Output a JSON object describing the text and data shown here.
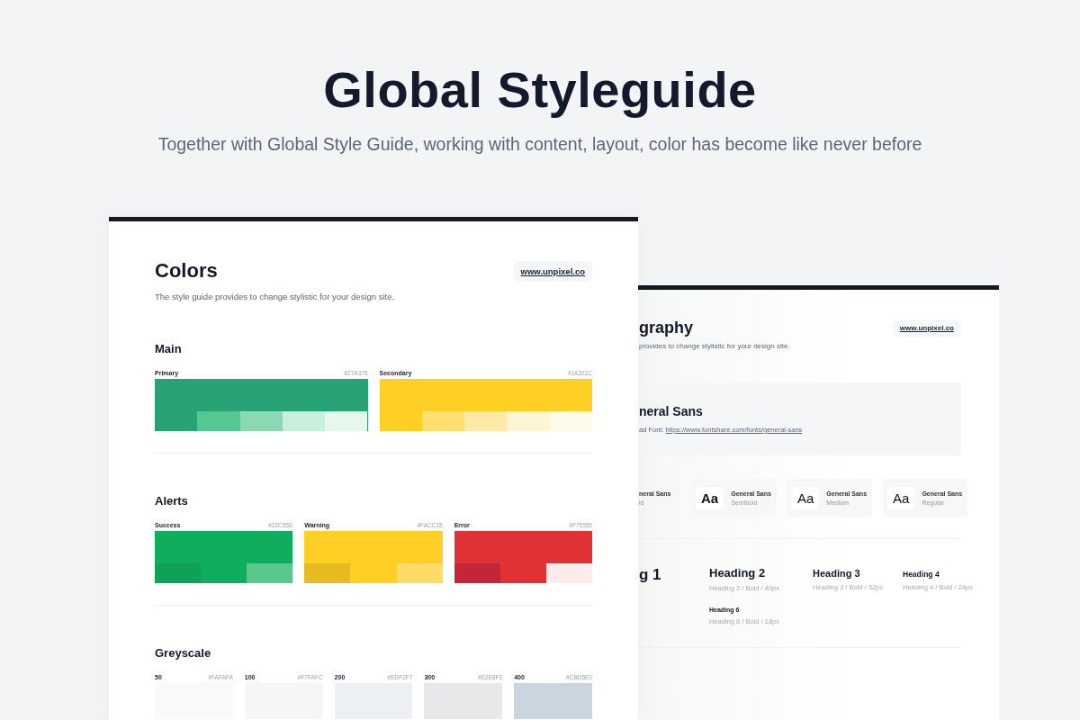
{
  "page": {
    "title": "Global Styleguide",
    "subtitle": "Together with Global Style Guide, working with content, layout, color has become like never before"
  },
  "colors_card": {
    "title": "Colors",
    "description": "The style guide provides to change stylistic for your design site.",
    "link": "www.unpixel.co",
    "sections": [
      {
        "heading": "Main",
        "kind": "tone",
        "swatches": [
          {
            "name": "Primary",
            "code": "#27A376",
            "color": "#27a376",
            "shades": [
              {
                "color": "#27a376"
              },
              {
                "color": "#55c791"
              },
              {
                "color": "#8ad9b0"
              },
              {
                "color": "#c9efdb"
              },
              {
                "color": "#e6f7ee"
              }
            ]
          },
          {
            "name": "Secondary",
            "code": "#1A202C",
            "color": "#ffd023",
            "shades": [
              {
                "color": "#ffd023"
              },
              {
                "color": "#ffe070"
              },
              {
                "color": "#ffeaa5"
              },
              {
                "color": "#fff4d3"
              },
              {
                "color": "#fffaea"
              }
            ]
          }
        ]
      },
      {
        "heading": "Alerts",
        "kind": "tone",
        "swatches": [
          {
            "name": "Success",
            "code": "#22C55E",
            "color": "#0fae5e",
            "shades": [
              {
                "color": "#0ea257"
              },
              {
                "color": "#0fae5e"
              },
              {
                "color": "#58c88d"
              }
            ]
          },
          {
            "name": "Warning",
            "code": "#FACC15",
            "color": "#ffd023",
            "shades": [
              {
                "color": "#e6bb22"
              },
              {
                "color": "#ffd023"
              },
              {
                "color": "#ffdd66"
              }
            ]
          },
          {
            "name": "Error",
            "code": "#F75555",
            "color": "#e03236",
            "shades": [
              {
                "color": "#c32638"
              },
              {
                "color": "#e03236"
              },
              {
                "color": "#fdecea"
              }
            ]
          }
        ]
      },
      {
        "heading": "Greyscale",
        "kind": "plain",
        "swatches": [
          {
            "name": "50",
            "code": "#FAFAFA",
            "color": "#f9f9f9"
          },
          {
            "name": "100",
            "code": "#F7FAFC",
            "color": "#f5f6f7"
          },
          {
            "name": "200",
            "code": "#EDF2F7",
            "color": "#edf0f2"
          },
          {
            "name": "300",
            "code": "#E2E8F0",
            "color": "#e6e8ea"
          },
          {
            "name": "400",
            "code": "#CBD5E0",
            "color": "#cbd5df"
          }
        ]
      }
    ]
  },
  "typography_card": {
    "title": "graphy",
    "description": "provides to change stylistic for your design site.",
    "link": "www.unpixel.co",
    "font": {
      "name": "neral Sans",
      "download_label": "ad Font: ",
      "url": "https://www.fontshare.com/fonts/general-sans"
    },
    "weights": [
      {
        "kind": "bold",
        "name": "neral Sans",
        "weight": "ld"
      },
      {
        "kind": "semibold",
        "sample": "Aa",
        "name": "General Sans",
        "weight": "Semibold"
      },
      {
        "kind": "medium",
        "sample": "Aa",
        "name": "General Sans",
        "weight": "Medium"
      },
      {
        "kind": "regular",
        "sample": "Aa",
        "name": "General Sans",
        "weight": "Regular"
      }
    ],
    "headings": [
      {
        "kind": "h1",
        "text": "g 1"
      },
      {
        "kind": "h2",
        "text": "Heading 2",
        "spec": "Heading 2 / Bold / 40px"
      },
      {
        "kind": "h3",
        "text": "Heading 3",
        "spec": "Heading 3 / Bold / 32px"
      },
      {
        "kind": "h4",
        "text": "Heading 4",
        "spec": "Heading 4 / Bold / 24px"
      },
      {
        "kind": "h6",
        "text": "Heading 6",
        "spec": "Heading 6 / Bold / 18px"
      }
    ]
  }
}
